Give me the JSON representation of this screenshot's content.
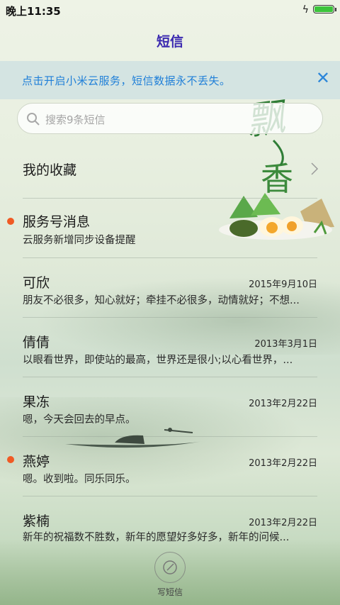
{
  "status": {
    "time": "晚上11:35",
    "charge_icon": "lightning-icon",
    "battery_level": 1.0,
    "battery_color": "#3bc43b"
  },
  "header": {
    "title": "短信",
    "title_color": "#3b2ab0"
  },
  "banner": {
    "text": "点击开启小米云服务，短信数据永不丢失。",
    "close_icon": "close-icon",
    "color": "#1f7fd8"
  },
  "search": {
    "placeholder": "搜索9条短信"
  },
  "favorites": {
    "label": "我的收藏"
  },
  "service": {
    "name": "服务号消息",
    "preview": "云服务新增同步设备提醒",
    "unread": true
  },
  "conversations": [
    {
      "name": "可欣",
      "date": "2015年9月10日",
      "preview": "朋友不必很多，知心就好；牵挂不必很多，动情就好；不想...",
      "unread": false
    },
    {
      "name": "倩倩",
      "date": "2013年3月1日",
      "preview": "以眼看世界，即使站的最高，世界还是很小;以心看世界，...",
      "unread": false
    },
    {
      "name": "果冻",
      "date": "2013年2月22日",
      "preview": "嗯，今天会回去的早点。",
      "unread": false
    },
    {
      "name": "燕婷",
      "date": "2013年2月22日",
      "preview": "嗯。收到啦。同乐同乐。",
      "unread": true
    },
    {
      "name": "紫楠",
      "date": "2013年2月22日",
      "preview": "新年的祝福数不胜数，新年的愿望好多好多，新年的问候...",
      "unread": false
    }
  ],
  "compose": {
    "label": "写短信",
    "icon": "compose-icon"
  },
  "decor": {
    "logo_text": "飘香",
    "unread_color": "#f05a24"
  }
}
